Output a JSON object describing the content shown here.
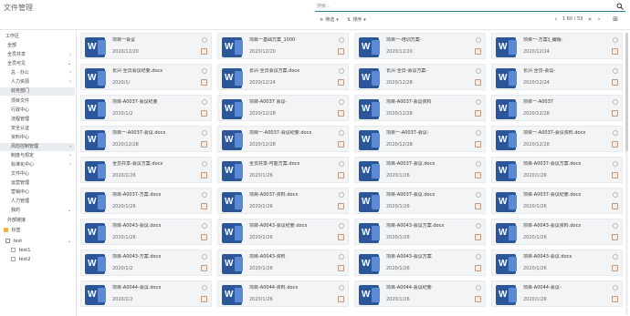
{
  "header": {
    "title": "文件管理",
    "search_placeholder": "搜索..."
  },
  "toolbar": {
    "filter_label": "筛选",
    "sort_label": "排序",
    "pager": "1 60 / 53"
  },
  "sidebar": {
    "section1": "工作区",
    "section2": "标签",
    "items": [
      {
        "label": "全部"
      },
      {
        "label": "全员共享"
      },
      {
        "label": "全员可见"
      },
      {
        "label": "总 · 办公"
      },
      {
        "label": "人力资源"
      },
      {
        "label": "财务部门"
      },
      {
        "label": "项目文件"
      },
      {
        "label": "行政中心"
      },
      {
        "label": "流程管理"
      },
      {
        "label": "安全认证"
      },
      {
        "label": "资料中心"
      },
      {
        "label": "风险控制管理"
      },
      {
        "label": "制度与规定"
      },
      {
        "label": "标准化中心"
      },
      {
        "label": "文件中心"
      },
      {
        "label": "运营管理"
      },
      {
        "label": "营销中心"
      },
      {
        "label": "人力管理"
      },
      {
        "label": "我的"
      },
      {
        "label": "外部链接"
      },
      {
        "label": "test"
      },
      {
        "label": "test1"
      },
      {
        "label": "test2"
      }
    ]
  },
  "cards": [
    {
      "name": "项目一会议",
      "date": "2020/12/20"
    },
    {
      "name": "项目一基础方案_1000",
      "date": "2020/12/20"
    },
    {
      "name": "项目一-培训方案-",
      "date": "2020/12/20"
    },
    {
      "name": "项目一-方案汇编版-",
      "date": "2020/12/24"
    },
    {
      "name": "长兴·全员会议纪要.docx",
      "date": "2020/1/"
    },
    {
      "name": "长兴·全员会议方案.docx",
      "date": "2020/12/24"
    },
    {
      "name": "长兴·全员-会议方案-",
      "date": "2020/12/28"
    },
    {
      "name": "长兴·全员-会议-",
      "date": "2020/12/24"
    },
    {
      "name": "项目-A0037·会议纪要",
      "date": "2020/1/2"
    },
    {
      "name": "项目-A0037 会议-",
      "date": "2020/12/28"
    },
    {
      "name": "项目-A0037·会议资料",
      "date": "2020/12/28"
    },
    {
      "name": "项目一-A0037",
      "date": "2020/12/28"
    },
    {
      "name": "项目一-A0037-会议.docx",
      "date": "2020/12/28"
    },
    {
      "name": "项目一-A0037-会议纪要.docx",
      "date": "2020/12/28"
    },
    {
      "name": "项目一-A0037-会议-",
      "date": "2020/12/28"
    },
    {
      "name": "项目一-A0037-会议资料.docx",
      "date": "2020/12/28"
    },
    {
      "name": "全员共享-会议方案.docx",
      "date": "2020/1/26"
    },
    {
      "name": "全员共享-可能方案.docx",
      "date": "2020/1/26"
    },
    {
      "name": "项目-A0037-会议.docx",
      "date": "2020/1/26"
    },
    {
      "name": "项目-A0037-会议方案.docx",
      "date": "2020/1/26"
    },
    {
      "name": "项目-A0037-方案.docx",
      "date": "2020/1/26"
    },
    {
      "name": "项目-A0037-资料.docx",
      "date": "2020/1/26"
    },
    {
      "name": "项目-A0037-会议.docx",
      "date": "2020/1/26"
    },
    {
      "name": "项目-A0037-会议纪要.docx",
      "date": "2020/1/26"
    },
    {
      "name": "项目-A0043-会议.docx",
      "date": "2020/1/26"
    },
    {
      "name": "项目-A0043-会议纪要.docx",
      "date": "2020/1/26"
    },
    {
      "name": "项目-A0043-会议方案.docx",
      "date": "2020/1/26"
    },
    {
      "name": "项目-A0043-会议资料.docx",
      "date": "2020/1/26"
    },
    {
      "name": "项目-A0043-方案.docx",
      "date": "2020/1/2"
    },
    {
      "name": "项目-A0043-资料",
      "date": "2020/1/26"
    },
    {
      "name": "项目-A0043-会议方案",
      "date": "2020/1/26"
    },
    {
      "name": "项目-A0043-会议.docx",
      "date": "2020/1/26"
    },
    {
      "name": "项目-A0044-会议.docx",
      "date": "2020/1/2"
    },
    {
      "name": "项目-A0044-资料.docx",
      "date": "2020/1/26"
    },
    {
      "name": "项目-A0044-会议纪要",
      "date": "2020/1/26"
    },
    {
      "name": "项目-A0044-会议-",
      "date": "2020/1/26"
    }
  ]
}
